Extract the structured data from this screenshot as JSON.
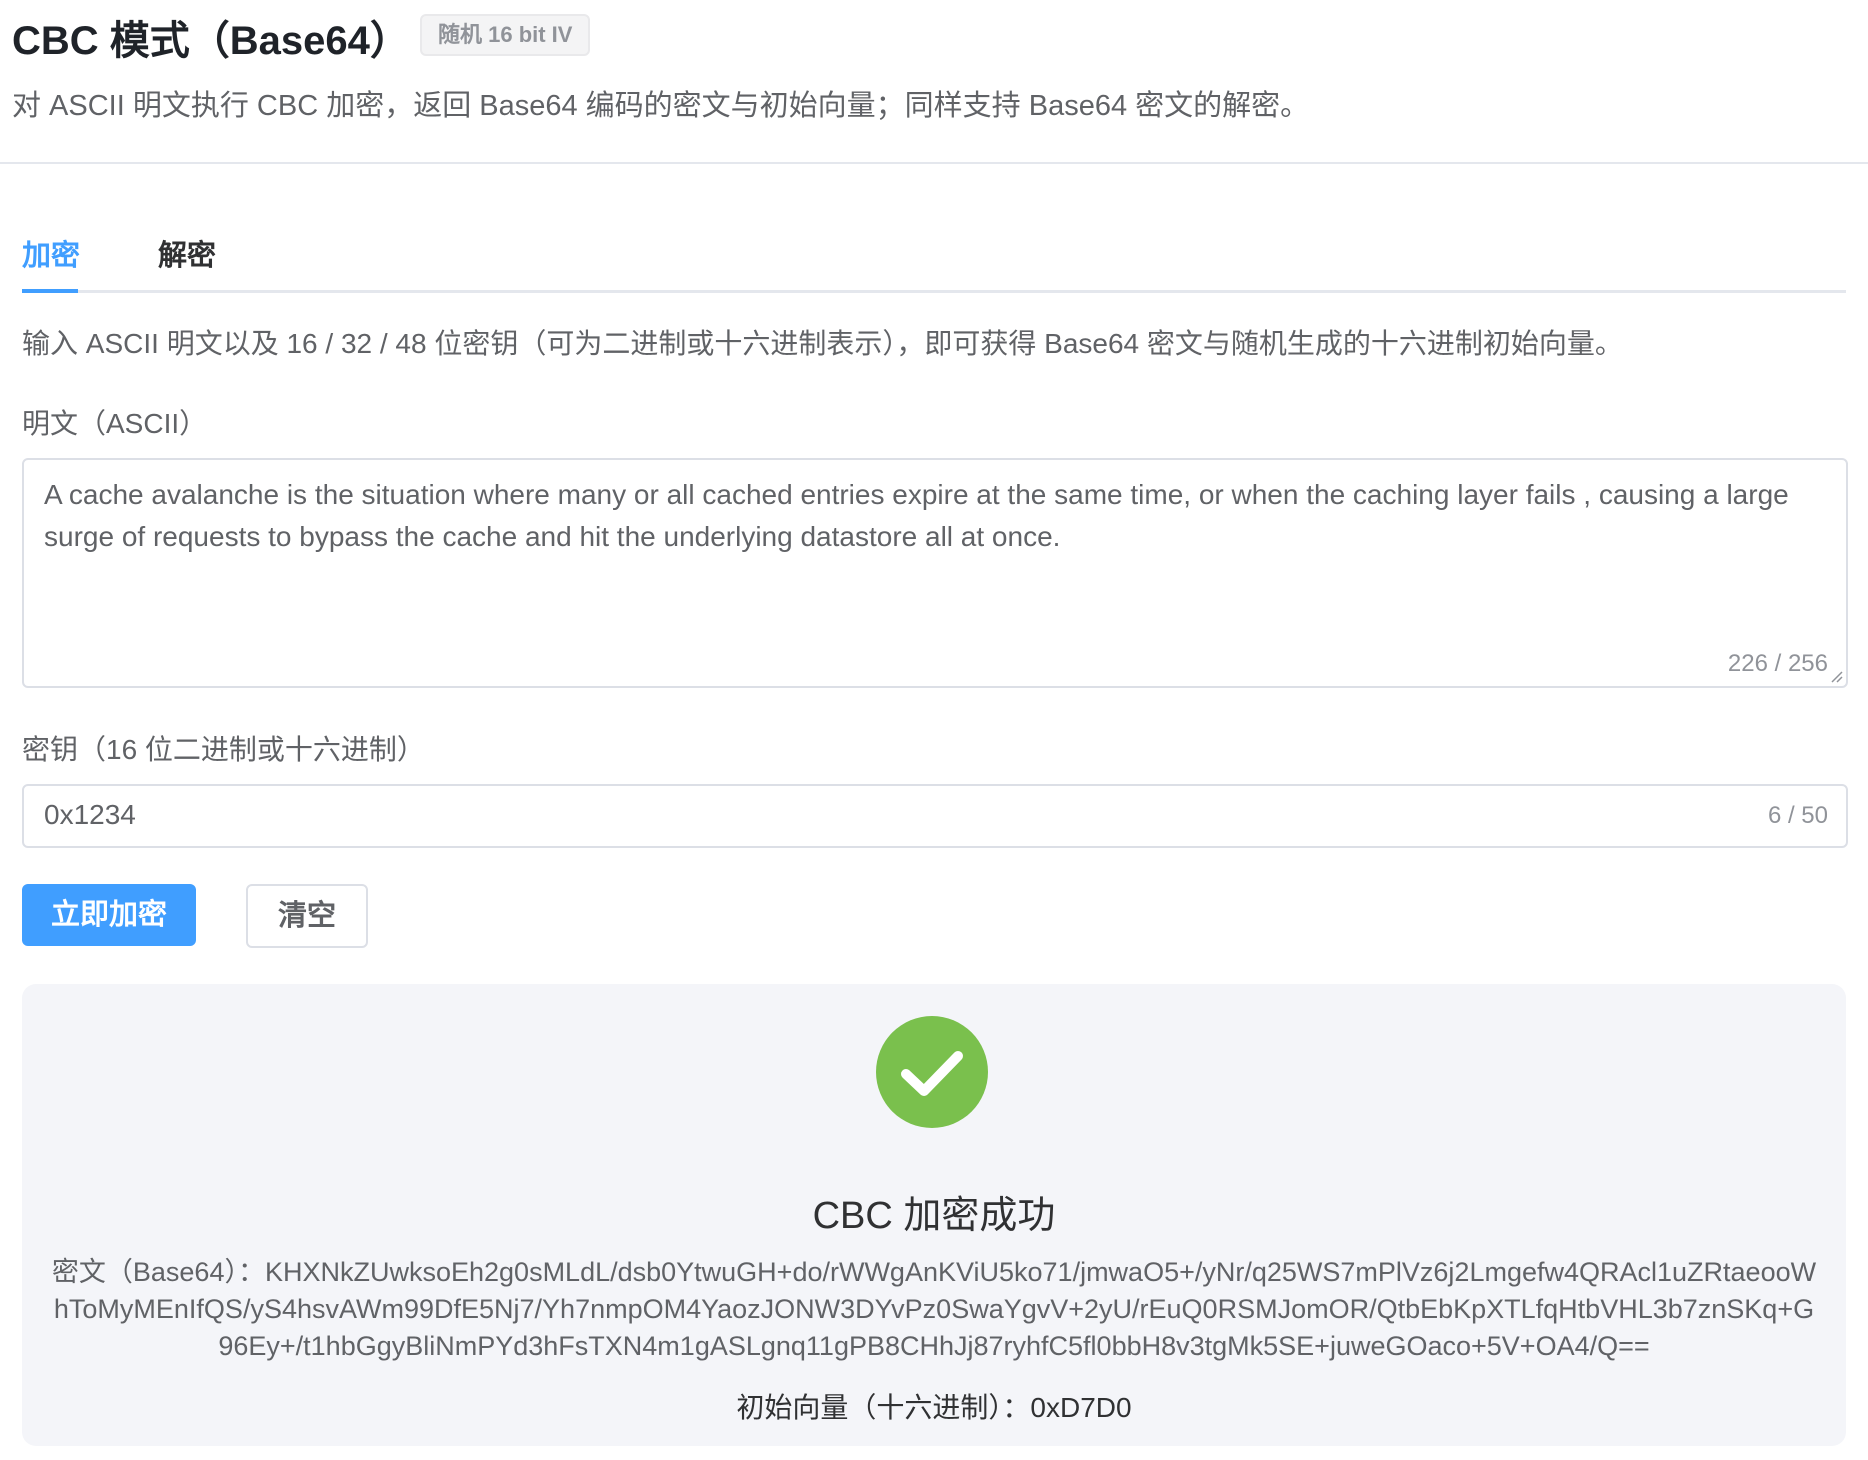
{
  "header": {
    "title": "CBC 模式（Base64）",
    "tag": "随机 16 bit IV",
    "description": "对 ASCII 明文执行 CBC 加密，返回 Base64 编码的密文与初始向量；同样支持 Base64 密文的解密。"
  },
  "tabs": [
    {
      "label": "加密",
      "active": true
    },
    {
      "label": "解密",
      "active": false
    }
  ],
  "form": {
    "intro": "输入 ASCII 明文以及 16 / 32 / 48 位密钥（可为二进制或十六进制表示），即可获得 Base64 密文与随机生成的十六进制初始向量。",
    "plaintext_label": "明文（ASCII）",
    "plaintext_value": "A cache avalanche is the situation where many or all cached entries expire at the same time, or when the caching layer fails , causing a large surge of requests to bypass the cache and hit the underlying datastore all at once.",
    "plaintext_counter": "226 / 256",
    "key_label": "密钥（16 位二进制或十六进制）",
    "key_value": "0x1234",
    "key_counter": "6 / 50",
    "encrypt_button": "立即加密",
    "clear_button": "清空"
  },
  "result": {
    "icon": "check-circle-icon",
    "status_color": "#7ac04d",
    "title": "CBC 加密成功",
    "ciphertext_label": "密文（Base64）：",
    "ciphertext": "KHXNkZUwksoEh2g0sMLdL/dsb0YtwuGH+do/rWWgAnKViU5ko71/jmwaO5+/yNr/q25WS7mPlVz6j2Lmgefw4QRAcl1uZRtaeooWhToMyMEnIfQS/yS4hsvAWm99DfE5Nj7/Yh7nmpOM4YaozJONW3DYvPz0SwaYgvV+2yU/rEuQ0RSMJomOR/QtbEbKpXTLfqHtbVHL3b7znSKq+G96Ey+/t1hbGgyBliNmPYd3hFsTXN4m1gASLgnq11gPB8CHhJj87ryhfC5fl0bbH8v3tgMk5SE+juweGOaco+5V+OA4/Q==",
    "iv_label": "初始向量（十六进制）：",
    "iv_value": "0xD7D0"
  },
  "colors": {
    "primary": "#409eff",
    "success": "#7ac04d"
  }
}
